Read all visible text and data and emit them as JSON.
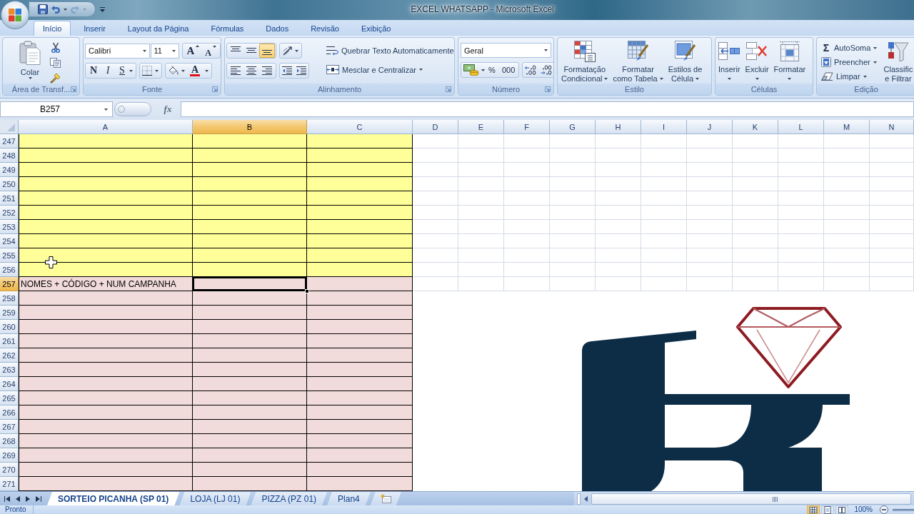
{
  "window": {
    "title": "EXCEL WHATSAPP - Microsoft Excel"
  },
  "quick_access": [
    {
      "kind": "save",
      "disabled": false
    },
    {
      "kind": "undo",
      "disabled": false
    },
    {
      "kind": "redo",
      "disabled": true
    }
  ],
  "ribbon_tabs": [
    {
      "label": "Início",
      "selected": true
    },
    {
      "label": "Inserir",
      "selected": false
    },
    {
      "label": "Layout da Página",
      "selected": false
    },
    {
      "label": "Fórmulas",
      "selected": false
    },
    {
      "label": "Dados",
      "selected": false
    },
    {
      "label": "Revisão",
      "selected": false
    },
    {
      "label": "Exibição",
      "selected": false
    }
  ],
  "ribbon": {
    "clipboard": {
      "title": "Área de Transf...",
      "paste": "Colar"
    },
    "font": {
      "title": "Fonte",
      "font_name": "Calibri",
      "font_size": "11",
      "grow": "A",
      "shrink": "A",
      "bold": "N",
      "italic": "I",
      "underline": "S",
      "font_color": "A"
    },
    "alignment": {
      "title": "Alinhamento",
      "vertical": [
        {
          "kind": "top",
          "selected": false
        },
        {
          "kind": "middle",
          "selected": false
        },
        {
          "kind": "bottom",
          "selected": true
        }
      ],
      "horizontal": [
        {
          "kind": "left",
          "selected": false
        },
        {
          "kind": "center",
          "selected": false
        },
        {
          "kind": "right",
          "selected": false
        }
      ],
      "wrap_text": "Quebrar Texto Automaticamente",
      "merge": "Mesclar e Centralizar"
    },
    "number": {
      "title": "Número",
      "format": "Geral",
      "percent": "%",
      "thousands": "000"
    },
    "styles": {
      "title": "Estilo",
      "buttons": [
        {
          "kind": "conditional",
          "lines": [
            "Formatação",
            "Condicional"
          ]
        },
        {
          "kind": "table",
          "lines": [
            "Formatar",
            "como Tabela"
          ]
        },
        {
          "kind": "cell_styles",
          "lines": [
            "Estilos de",
            "Célula"
          ]
        }
      ]
    },
    "cells": {
      "title": "Células",
      "buttons": [
        {
          "kind": "insert",
          "label": "Inserir"
        },
        {
          "kind": "delete",
          "label": "Excluir"
        },
        {
          "kind": "format",
          "label": "Formatar"
        }
      ]
    },
    "editing": {
      "title": "Edição",
      "items": [
        {
          "kind": "autosum",
          "symbol": "Σ",
          "label": "AutoSoma"
        },
        {
          "kind": "fill",
          "label": "Preencher"
        },
        {
          "kind": "clear",
          "label": "Limpar"
        }
      ],
      "sort_filter": [
        "Classific",
        "e Filtrar"
      ]
    }
  },
  "formula_bar": {
    "name_box": "B257",
    "function_label": "fx"
  },
  "sheet": {
    "columns": [
      {
        "label": "A",
        "selected": false
      },
      {
        "label": "B",
        "selected": true
      },
      {
        "label": "C",
        "selected": false
      },
      {
        "label": "D",
        "selected": false
      },
      {
        "label": "E",
        "selected": false
      },
      {
        "label": "F",
        "selected": false
      },
      {
        "label": "G",
        "selected": false
      },
      {
        "label": "H",
        "selected": false
      },
      {
        "label": "I",
        "selected": false
      },
      {
        "label": "J",
        "selected": false
      },
      {
        "label": "K",
        "selected": false
      },
      {
        "label": "L",
        "selected": false
      },
      {
        "label": "M",
        "selected": false
      },
      {
        "label": "N",
        "selected": false
      }
    ],
    "rows": [
      {
        "number": "247",
        "selected": false,
        "color": "#ffff99"
      },
      {
        "number": "248",
        "selected": false,
        "color": "#ffff99"
      },
      {
        "number": "249",
        "selected": false,
        "color": "#ffff99"
      },
      {
        "number": "250",
        "selected": false,
        "color": "#ffff99"
      },
      {
        "number": "251",
        "selected": false,
        "color": "#ffff99"
      },
      {
        "number": "252",
        "selected": false,
        "color": "#ffff99"
      },
      {
        "number": "253",
        "selected": false,
        "color": "#ffff99"
      },
      {
        "number": "254",
        "selected": false,
        "color": "#ffff99"
      },
      {
        "number": "255",
        "selected": false,
        "color": "#ffff99"
      },
      {
        "number": "256",
        "selected": false,
        "color": "#ffff99"
      },
      {
        "number": "257",
        "selected": true,
        "color": "#f2dcdb",
        "cells": [
          "NOMES + CÓDIGO + NUM CAMPANHA"
        ]
      },
      {
        "number": "258",
        "selected": false,
        "color": "#f2dcdb"
      },
      {
        "number": "259",
        "selected": false,
        "color": "#f2dcdb"
      },
      {
        "number": "260",
        "selected": false,
        "color": "#f2dcdb"
      },
      {
        "number": "261",
        "selected": false,
        "color": "#f2dcdb"
      },
      {
        "number": "262",
        "selected": false,
        "color": "#f2dcdb"
      },
      {
        "number": "263",
        "selected": false,
        "color": "#f2dcdb"
      },
      {
        "number": "264",
        "selected": false,
        "color": "#f2dcdb"
      },
      {
        "number": "265",
        "selected": false,
        "color": "#f2dcdb"
      },
      {
        "number": "266",
        "selected": false,
        "color": "#f2dcdb"
      },
      {
        "number": "267",
        "selected": false,
        "color": "#f2dcdb"
      },
      {
        "number": "268",
        "selected": false,
        "color": "#f2dcdb"
      },
      {
        "number": "269",
        "selected": false,
        "color": "#f2dcdb"
      },
      {
        "number": "270",
        "selected": false,
        "color": "#f2dcdb"
      },
      {
        "number": "271",
        "selected": false,
        "color": "#f2dcdb"
      }
    ]
  },
  "sheet_tabs": [
    {
      "label": "SORTEIO PICANHA (SP 01)",
      "selected": true
    },
    {
      "label": "LOJA (LJ 01)",
      "selected": false
    },
    {
      "label": "PIZZA (PZ 01)",
      "selected": false
    },
    {
      "label": "Plan4",
      "selected": false
    }
  ],
  "status_bar": {
    "status": "Pronto",
    "views": [
      {
        "kind": "normal",
        "selected": true
      },
      {
        "kind": "page_layout",
        "selected": false
      },
      {
        "kind": "page_break",
        "selected": false
      }
    ],
    "zoom": "100%"
  }
}
